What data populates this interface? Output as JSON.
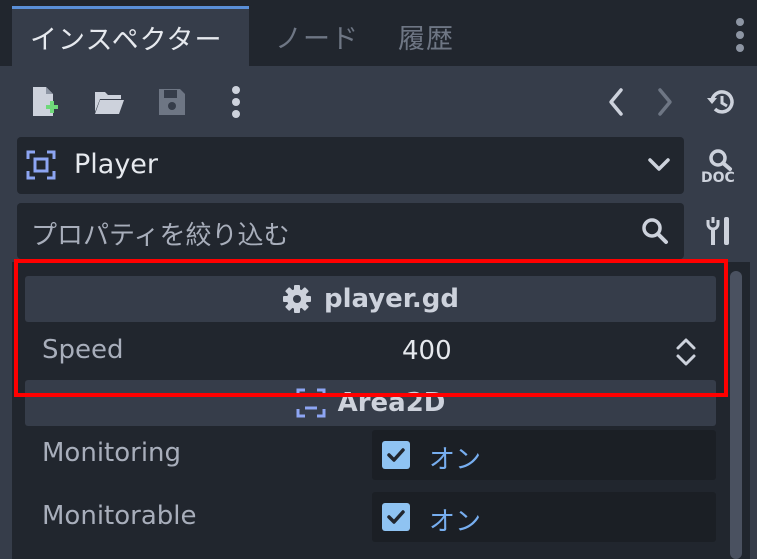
{
  "tabs": [
    {
      "label": "インスペクター",
      "active": true
    },
    {
      "label": "ノード",
      "active": false
    },
    {
      "label": "履歴",
      "active": false
    }
  ],
  "toolbar": {
    "icons": [
      "new-resource-icon",
      "open-folder-icon",
      "save-icon",
      "more-options-icon",
      "back-icon",
      "forward-icon",
      "history-icon"
    ],
    "back_glyph": "〈",
    "forward_glyph": "〉"
  },
  "object_picker": {
    "label": "Player",
    "icon": "node-selector-icon"
  },
  "doc_button": {
    "icon": "doc-icon",
    "label": "DOC"
  },
  "filter": {
    "placeholder": "プロパティを絞り込む"
  },
  "sections": [
    {
      "title": "player.gd",
      "icon": "gear-icon",
      "properties": [
        {
          "label": "Speed",
          "value": "400",
          "type": "spin"
        }
      ]
    },
    {
      "title": "Area2D",
      "icon": "area2d-icon",
      "properties": [
        {
          "label": "Monitoring",
          "value": "オン",
          "checked": true,
          "type": "check"
        },
        {
          "label": "Monitorable",
          "value": "オン",
          "checked": true,
          "type": "check"
        }
      ]
    }
  ],
  "colors": {
    "accent": "#5a8fd8",
    "panel": "#363d4a",
    "field": "#21262e",
    "check": "#8fc3f2",
    "on_text": "#77aef0",
    "highlight": "#ff0000"
  }
}
